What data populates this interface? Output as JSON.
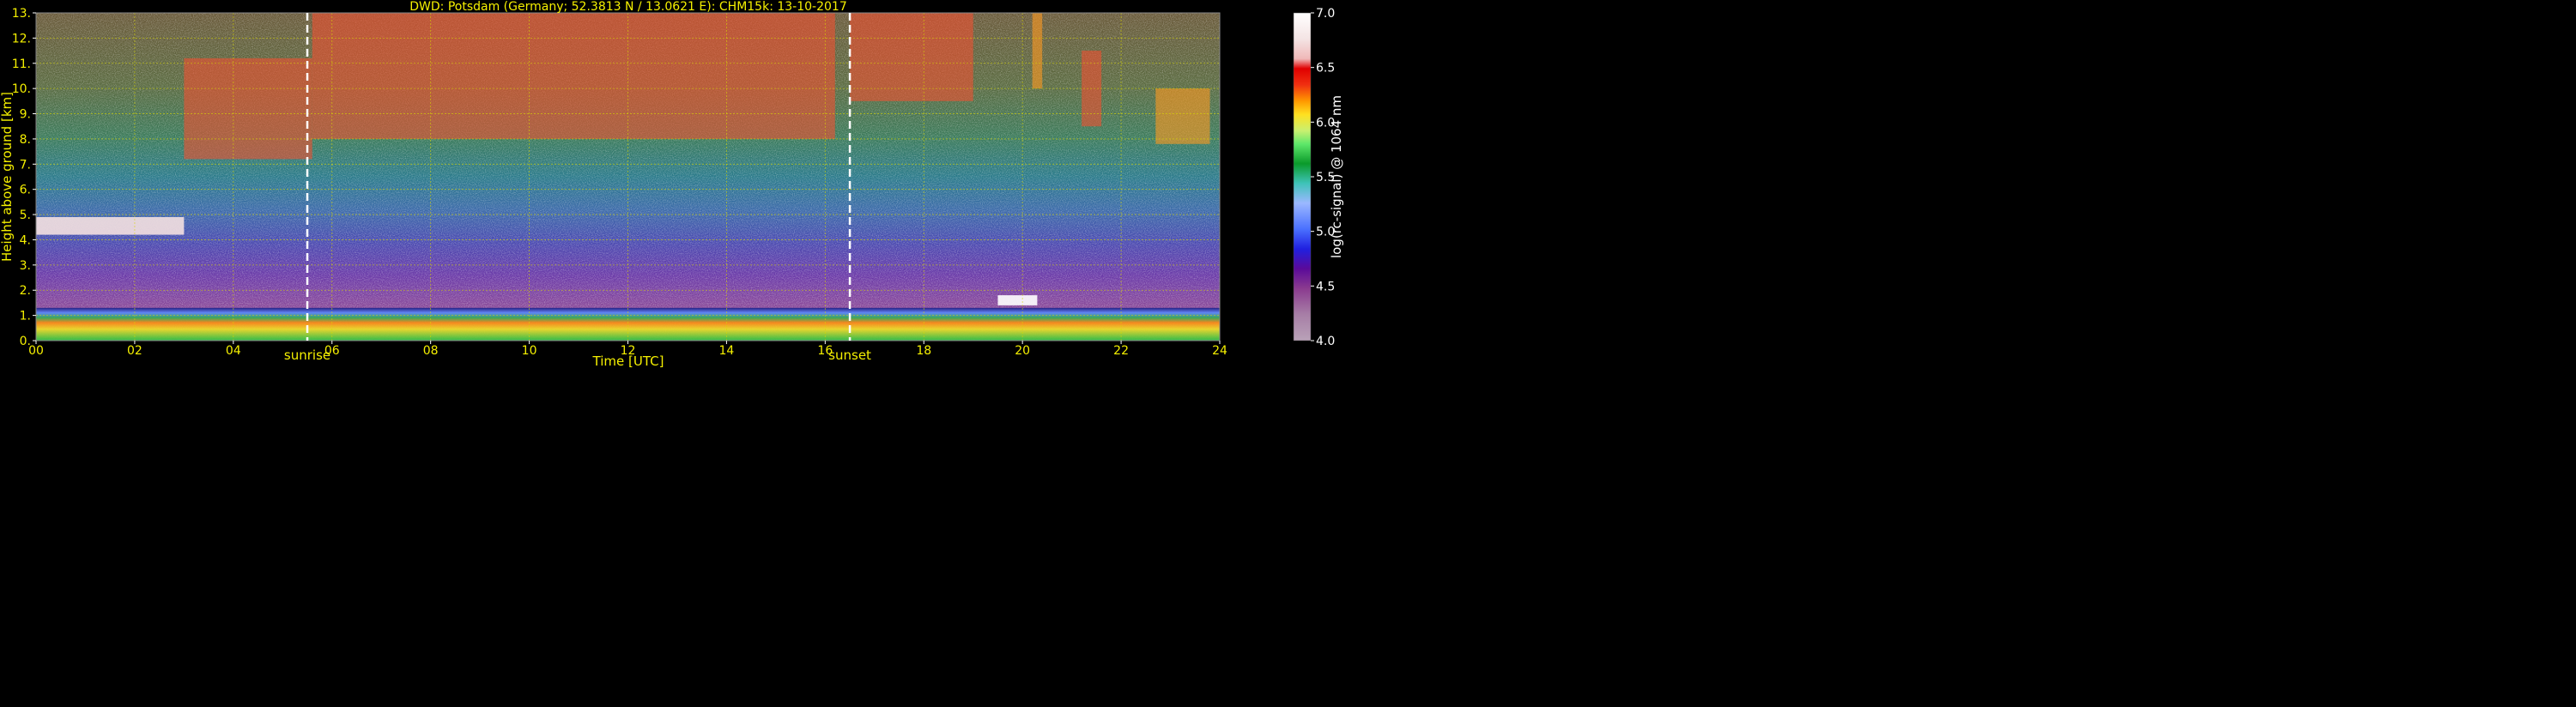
{
  "chart_data": {
    "type": "heatmap",
    "title": "DWD: Potsdam (Germany; 52.3813 N / 13.0621 E):    CHM15k: 13-10-2017",
    "xlabel": "Time [UTC]",
    "ylabel": "Height above ground [km]",
    "xlim": [
      0,
      24
    ],
    "ylim": [
      0,
      13
    ],
    "x_ticks": [
      "00",
      "02",
      "04",
      "06",
      "08",
      "10",
      "12",
      "14",
      "16",
      "18",
      "20",
      "22",
      "24"
    ],
    "y_ticks": [
      "0.",
      "1.",
      "2.",
      "3.",
      "4.",
      "5.",
      "6.",
      "7.",
      "8.",
      "9.",
      "10.",
      "11.",
      "12.",
      "13."
    ],
    "grid": true,
    "colorbar": {
      "label": "log(rc-signal) @ 1064 nm",
      "range": [
        4.0,
        7.0
      ],
      "ticks": [
        "4.0",
        "4.5",
        "5.0",
        "5.5",
        "6.0",
        "6.5",
        "7.0"
      ]
    },
    "markers": [
      {
        "name": "sunrise",
        "x": 5.5
      },
      {
        "name": "sunset",
        "x": 16.5
      }
    ],
    "layers": [
      {
        "kind": "boundary layer aerosol",
        "x": [
          0,
          24
        ],
        "y": [
          0.0,
          1.3
        ],
        "value": 5.7
      },
      {
        "kind": "cloud",
        "x": [
          0,
          3.0
        ],
        "y": [
          4.2,
          4.9
        ],
        "value": 6.6
      },
      {
        "kind": "cirrus",
        "x": [
          3.0,
          5.6
        ],
        "y": [
          7.2,
          11.2
        ],
        "value": 6.3
      },
      {
        "kind": "cirrus",
        "x": [
          5.6,
          16.2
        ],
        "y": [
          8.0,
          13.0
        ],
        "value": 6.2
      },
      {
        "kind": "cirrus",
        "x": [
          16.5,
          19.0
        ],
        "y": [
          9.5,
          13.0
        ],
        "value": 6.3
      },
      {
        "kind": "cirrus",
        "x": [
          20.2,
          20.4
        ],
        "y": [
          10.0,
          13.0
        ],
        "value": 6.1
      },
      {
        "kind": "cirrus",
        "x": [
          21.2,
          21.6
        ],
        "y": [
          8.5,
          11.5
        ],
        "value": 6.2
      },
      {
        "kind": "cirrus",
        "x": [
          22.7,
          23.8
        ],
        "y": [
          7.8,
          10.0
        ],
        "value": 6.1
      },
      {
        "kind": "low cloud",
        "x": [
          19.5,
          20.3
        ],
        "y": [
          1.4,
          1.8
        ],
        "value": 7.0
      }
    ]
  }
}
